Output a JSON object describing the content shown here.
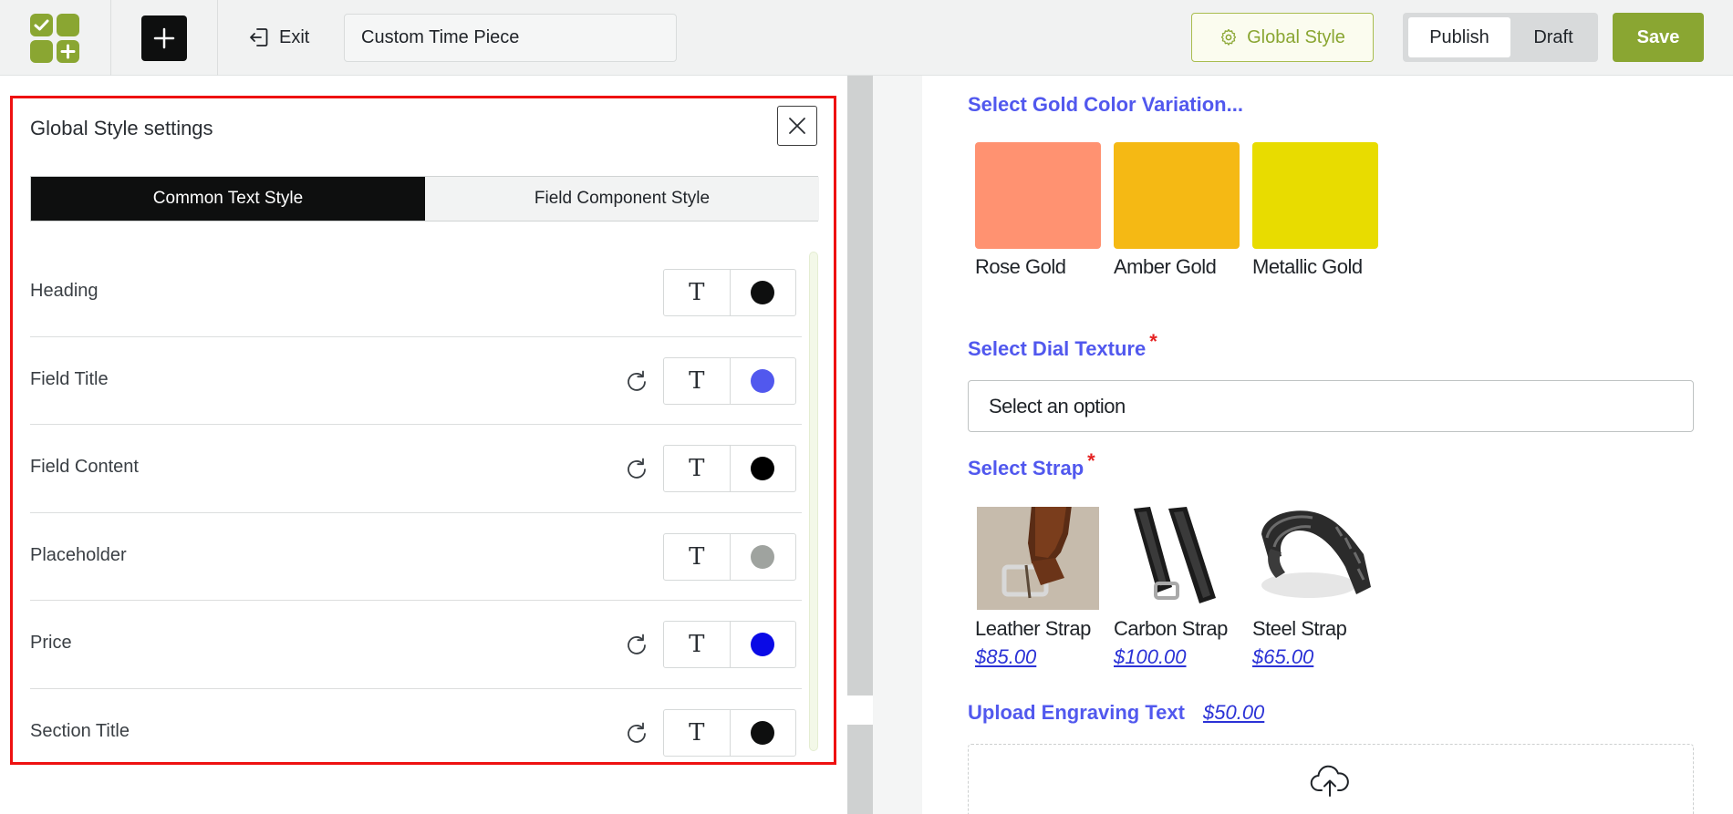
{
  "topbar": {
    "exit_label": "Exit",
    "product_title": "Custom Time Piece",
    "global_style_label": "Global Style",
    "publish_label": "Publish",
    "draft_label": "Draft",
    "save_label": "Save",
    "accent_color": "#8aa632"
  },
  "panel": {
    "title": "Global Style settings",
    "tabs": [
      {
        "label": "Common Text Style",
        "active": true
      },
      {
        "label": "Field Component Style",
        "active": false
      }
    ],
    "rows": [
      {
        "label": "Heading",
        "has_reset": false,
        "color": "#0e0f0f"
      },
      {
        "label": "Field Title",
        "has_reset": true,
        "color": "#5158ee"
      },
      {
        "label": "Field Content",
        "has_reset": true,
        "color": "#000000"
      },
      {
        "label": "Placeholder",
        "has_reset": false,
        "color": "#9fa39f"
      },
      {
        "label": "Price",
        "has_reset": true,
        "color": "#0a0ae6"
      },
      {
        "label": "Section Title",
        "has_reset": true,
        "color": "#0e0f0f"
      }
    ],
    "font_glyph": "T"
  },
  "preview": {
    "gold_title": "Select Gold Color Variation...",
    "gold_options": [
      {
        "label": "Rose Gold",
        "color": "#ff9271"
      },
      {
        "label": "Amber Gold",
        "color": "#f5b914"
      },
      {
        "label": "Metallic Gold",
        "color": "#e8dc00"
      }
    ],
    "dial_title": "Select Dial Texture",
    "required_mark": "*",
    "dial_placeholder": "Select an option",
    "strap_title": "Select Strap",
    "strap_options": [
      {
        "label": "Leather Strap",
        "price": "$85.00"
      },
      {
        "label": "Carbon Strap",
        "price": "$100.00"
      },
      {
        "label": "Steel Strap",
        "price": "$65.00"
      }
    ],
    "engraving_title": "Upload Engraving Text",
    "engraving_price": "$50.00"
  }
}
